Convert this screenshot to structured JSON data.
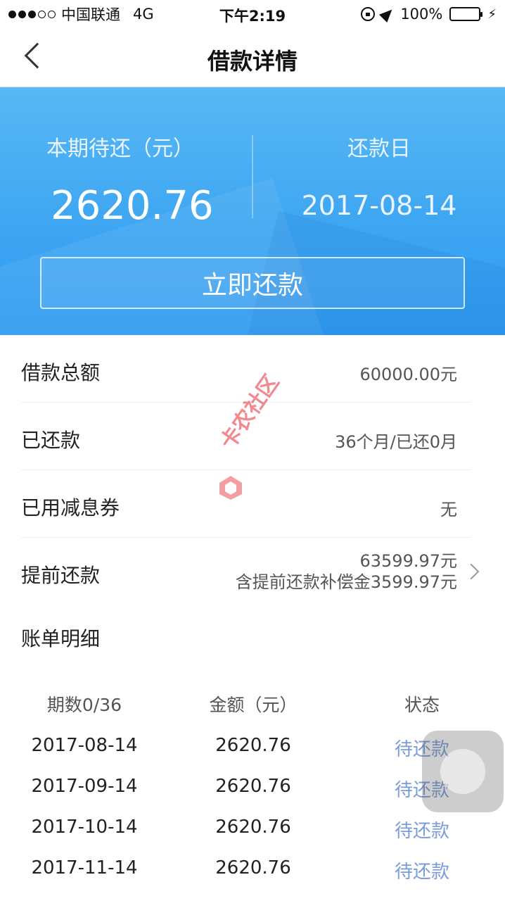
{
  "status_bar": {
    "carrier": "中国联通",
    "network": "4G",
    "time": "下午2:19",
    "battery": "100%",
    "battery_level": 1.0,
    "signal_level": 3
  },
  "nav": {
    "title": "借款详情"
  },
  "hero": {
    "due_label": "本期待还（元）",
    "due_amount": "2620.76",
    "date_label": "还款日",
    "date_value": "2017-08-14",
    "repay_button": "立即还款"
  },
  "info": {
    "total_label": "借款总额",
    "total_value": "60000.00元",
    "repaid_label": "已还款",
    "repaid_value": "36个月/已还0月",
    "coupon_label": "已用减息券",
    "coupon_value": "无",
    "prepay_label": "提前还款",
    "prepay_value": "63599.97元",
    "prepay_note": "含提前还款补偿金3599.97元"
  },
  "bill": {
    "section_title": "账单明细",
    "headers": [
      "期数0/36",
      "金额（元）",
      "状态"
    ],
    "rows": [
      {
        "date": "2017-08-14",
        "amount": "2620.76",
        "status": "待还款"
      },
      {
        "date": "2017-09-14",
        "amount": "2620.76",
        "status": "待还款"
      },
      {
        "date": "2017-10-14",
        "amount": "2620.76",
        "status": "待还款"
      },
      {
        "date": "2017-11-14",
        "amount": "2620.76",
        "status": "待还款"
      }
    ]
  },
  "watermark": "卡农社区",
  "colors": {
    "hero_blue": "#3ea6f2",
    "pending_status": "#7a9cd8",
    "battery_green": "#3ccd3c",
    "watermark_red": "#e62832"
  }
}
